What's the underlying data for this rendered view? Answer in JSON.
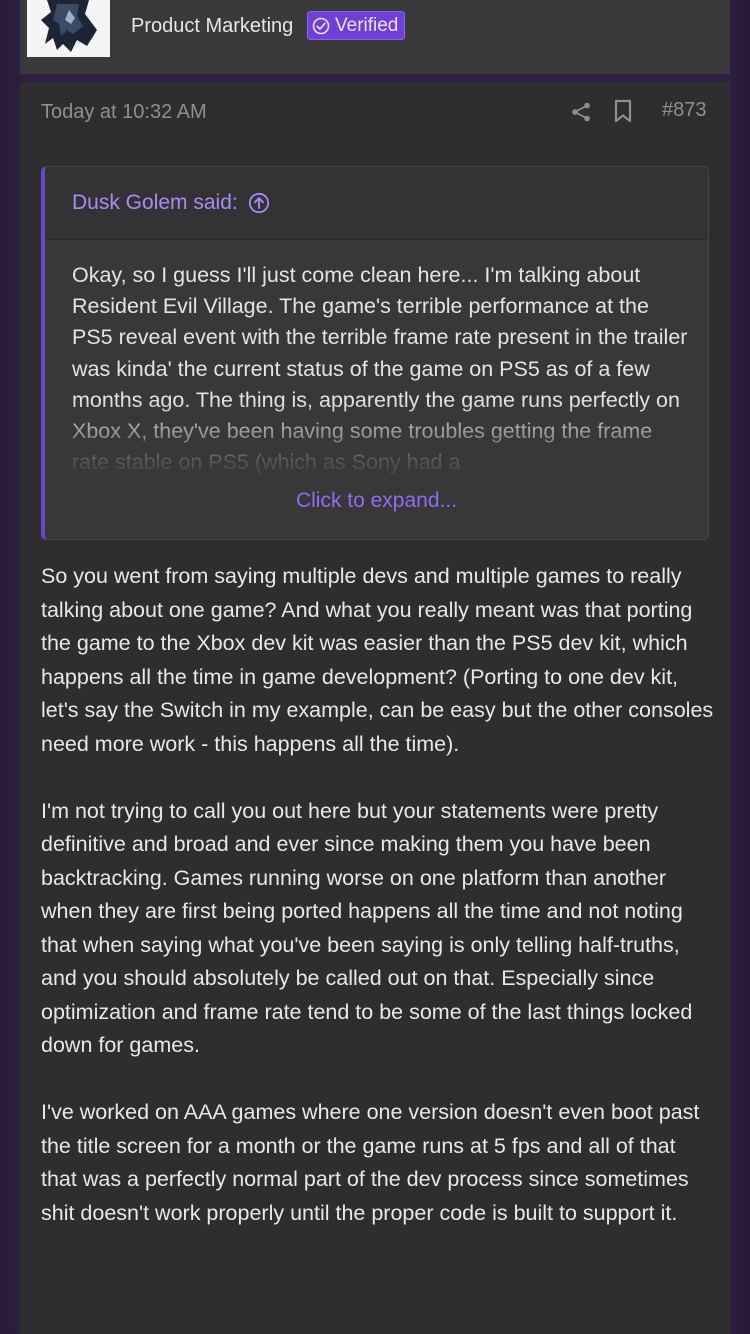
{
  "header": {
    "role": "Product Marketing",
    "verified_label": "Verified"
  },
  "post": {
    "timestamp": "Today at 10:32 AM",
    "number": "#873",
    "icons": {
      "share": "share-icon",
      "bookmark": "bookmark-icon",
      "quote_jump": "arrow-up-circle-icon",
      "verified": "check-circle-icon"
    },
    "quote": {
      "author_label": "Dusk Golem said:",
      "text": "Okay, so I guess I'll just come clean here... I'm talking about Resident Evil Village. The game's terrible performance at the PS5 reveal event with the terrible frame rate present in the trailer was kinda' the current status of the game on PS5 as of a few months ago. The thing is, apparently the game runs perfectly on Xbox X, they've been having some troubles getting the frame rate stable on PS5 (which as Sony had a",
      "expand_label": "Click to expand..."
    },
    "paragraphs": [
      "So you went from saying multiple devs and multiple games to really talking about one game? And what you really meant was that porting the game to the Xbox dev kit was easier than the PS5 dev kit, which happens all the time in game development? (Porting to one dev kit, let's say the Switch in my example, can be easy but the other consoles need more work - this happens all the time).",
      "I'm not trying to call you out here but your statements were pretty definitive and broad and ever since making them you have been backtracking. Games running worse on one platform than another when they are first being ported happens all the time and not noting that when saying what you've been saying is only telling half-truths, and you should absolutely be called out on that. Especially since optimization and frame rate tend to be some of the last things locked down for games.",
      "I've worked on AAA games where one version doesn't even boot past the title screen for a month or the game runs at 5 fps and all of that that was a perfectly normal part of the dev process since sometimes shit doesn't work properly until the proper code is built to support it."
    ]
  },
  "colors": {
    "accent": "#6f3fd6",
    "quote_link": "#a98bf2",
    "background": "#2c1f40",
    "card": "#2e2e30"
  }
}
